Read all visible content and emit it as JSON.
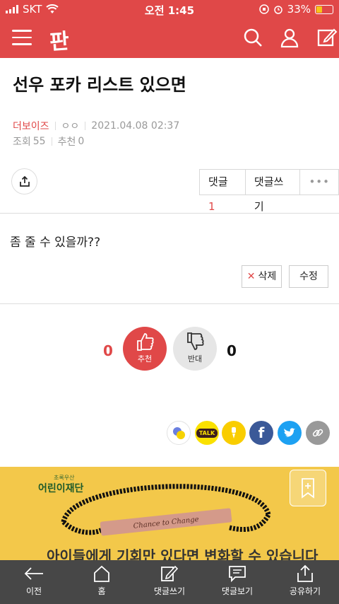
{
  "status_bar": {
    "carrier": "SKT",
    "time": "오전 1:45",
    "battery_pct": "33%"
  },
  "header": {
    "logo": "판"
  },
  "post": {
    "title": "선우 포카 리스트 있으면",
    "author": "더보이즈",
    "author_extra": "ㅇㅇ",
    "date": "2021.04.08 02:37",
    "views_label": "조회",
    "views": "55",
    "recommend_label": "추천",
    "recommend": "0",
    "body": "좀 줄 수 있을까??"
  },
  "actions": {
    "comments_label": "댓글",
    "comments_count": "1",
    "write_comment": "댓글쓰기",
    "more": "•••",
    "delete": "삭제",
    "edit": "수정"
  },
  "votes": {
    "up_count": "0",
    "up_label": "추천",
    "down_count": "0",
    "down_label": "반대"
  },
  "share": {
    "items": [
      "sns-generic",
      "kakaotalk",
      "kakaostory",
      "facebook",
      "twitter",
      "link"
    ],
    "talk_text": "TALK"
  },
  "ad": {
    "brand_small": "초록우산",
    "brand": "어린이재단",
    "slogan": "아이들에게 기회만 있다면 변화할 수 있습니다",
    "engraving": "Chance to Change"
  },
  "bottom_nav": [
    {
      "label": "이전",
      "icon": "arrow-left-icon"
    },
    {
      "label": "홈",
      "icon": "home-icon"
    },
    {
      "label": "댓글쓰기",
      "icon": "write-comment-icon"
    },
    {
      "label": "댓글보기",
      "icon": "view-comments-icon"
    },
    {
      "label": "공유하기",
      "icon": "share-icon"
    }
  ],
  "colors": {
    "brand_red": "#e04848",
    "bottom_bar": "#474747",
    "ad_bg": "#f3c84a",
    "facebook": "#3b5998",
    "twitter": "#1da1f2",
    "kakao": "#fae100"
  }
}
